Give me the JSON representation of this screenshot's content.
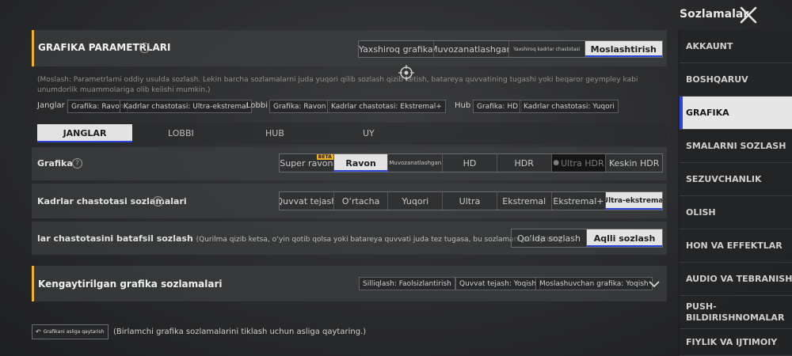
{
  "header": {
    "title": "Sozlamalar",
    "close_icon": "close-icon"
  },
  "sidebar": {
    "items": [
      {
        "label": "AKKAUNT",
        "active": false
      },
      {
        "label": "BOSHQARUV",
        "active": false
      },
      {
        "label": "GRAFIKA",
        "active": true
      },
      {
        "label": "SMALARNI SOZLASH",
        "active": false
      },
      {
        "label": "SEZUVCHANLIK",
        "active": false
      },
      {
        "label": "OLISH",
        "active": false
      },
      {
        "label": "HON VA EFFEKTLAR",
        "active": false
      },
      {
        "label": "AUDIO VA TEBRANISH",
        "active": false
      },
      {
        "label": "PUSH-BILDIRISHNOMALAR",
        "active": false
      },
      {
        "label": "FIYLIK VA IJTIMOIY",
        "active": false
      }
    ]
  },
  "params": {
    "title": "GRAFIKA PARAMETRLARI",
    "presets": [
      "Yaxshiroq grafika",
      "Muvozanatlashgan",
      "Yaxshiroq kadrlar chastotasi",
      "Moslashtirish"
    ],
    "preset_selected": "Moslashtirish",
    "note": "(Moslash: Parametrlarni oddiy usulda sozlash. Lekin barcha sozlamalarni juda yuqori qilib sozlash qizib ketish, batareya quvvatining tugashi yoki beqaror geympley kabi unumdorlik muammolariga olib kelishi mumkin.)",
    "summary": {
      "janglar_label": "Janglar",
      "janglar_grafika": "Grafika: Ravon",
      "janglar_fps": "Kadrlar chastotasi: Ultra-ekstremal",
      "lobbi_label": "Lobbi",
      "lobbi_grafika": "Grafika: Ravon",
      "lobbi_fps": "Kadrlar chastotasi: Ekstremal+",
      "hub_label": "Hub",
      "hub_grafika": "Grafika: HD",
      "hub_fps": "Kadrlar chastotasi: Yuqori"
    }
  },
  "tabs": [
    {
      "label": "JANGLAR",
      "active": true
    },
    {
      "label": "LOBBI",
      "active": false
    },
    {
      "label": "HUB",
      "active": false
    },
    {
      "label": "UY",
      "active": false
    }
  ],
  "grafika": {
    "label": "Grafika",
    "options": [
      "Super ravon",
      "Ravon",
      "Muvozanatlashgan",
      "HD",
      "HDR",
      "Ultra HDR",
      "Keskin HDR"
    ],
    "selected": "Ravon",
    "beta_badge": "BETA"
  },
  "fps": {
    "label": "Kadrlar chastotasi sozlamalari",
    "options": [
      "Quvvat tejash",
      "O‘rtacha",
      "Yuqori",
      "Ultra",
      "Ekstremal",
      "Ekstremal+",
      "Ultra-ekstremal"
    ],
    "selected": "Ultra-ekstremal"
  },
  "detail": {
    "label": "lar chastotasini batafsil sozlash",
    "hint": "(Qurilma qizib ketsa, o‘yin qotib qolsa yoki batareya quvvati juda tez tugasa, bu sozlamani pasaytiring)",
    "options": [
      "Qo‘lda sozlash",
      "Aqlli sozlash"
    ],
    "selected": "Aqlli sozlash"
  },
  "advanced": {
    "title": "Kengaytirilgan grafika sozlamalari",
    "chips": [
      "Silliqlash: Faolsizlantirish",
      "Quvvat tejash: Yoqish",
      "Moslashuvchan grafika: Yoqish"
    ]
  },
  "reset": {
    "button_label": "Grafikani asliga qaytarish",
    "description": "(Birlamchi grafika sozlamalarini tiklash uchun asliga qaytaring.)"
  },
  "colors": {
    "accent": "#f0b323",
    "selected_underline": "#2a47d8",
    "selected_bg": "#e3e3e3"
  }
}
